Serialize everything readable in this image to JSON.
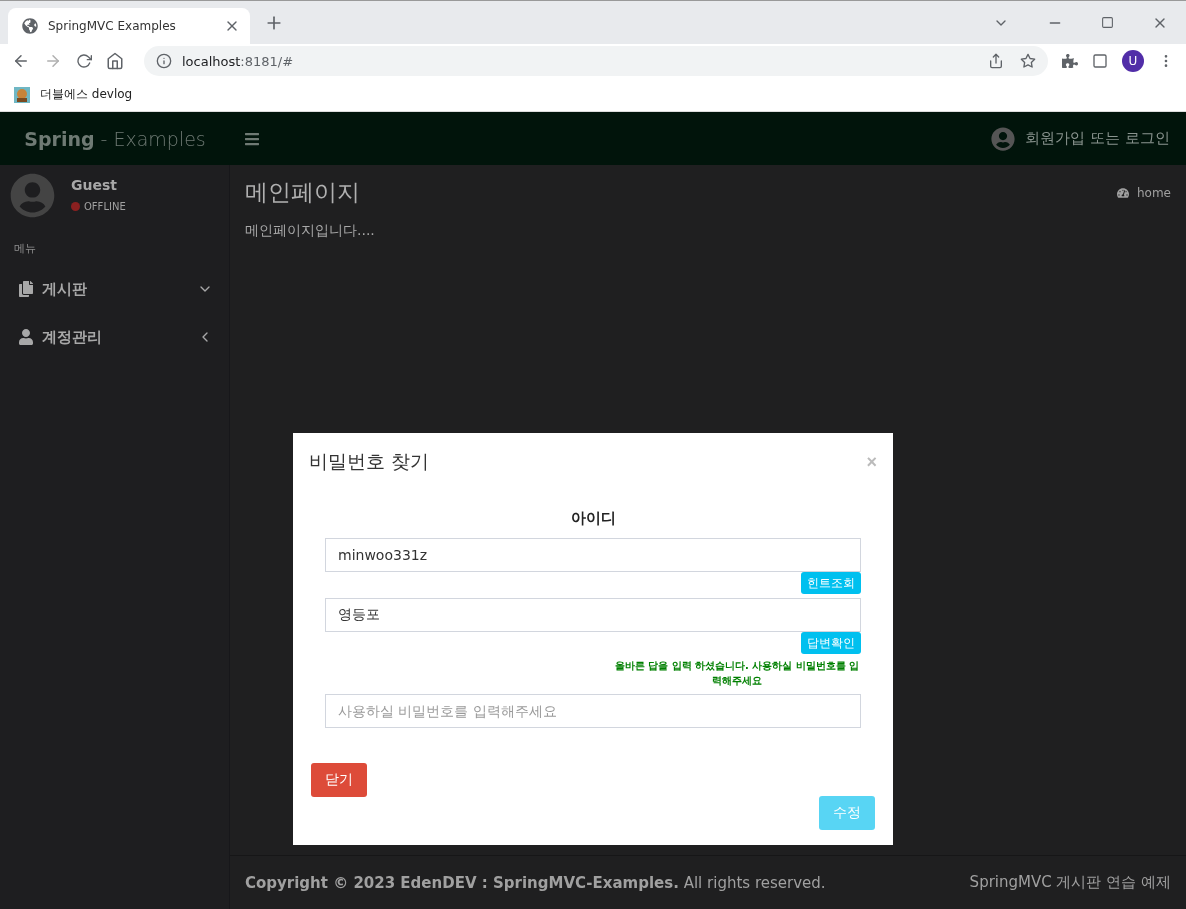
{
  "browser": {
    "tab_title": "SpringMVC Examples",
    "url_host": "localhost",
    "url_rest": ":8181/#",
    "bookmarks": [
      "더블에스 devlog"
    ],
    "profile_initial": "U"
  },
  "header": {
    "brand_bold": "Spring",
    "brand_rest": "- Examples",
    "account_link": "회원가입 또는 로그인"
  },
  "sidebar": {
    "user_name": "Guest",
    "status": "OFFLINE",
    "menu_header": "메뉴",
    "items": [
      {
        "label": "게시판",
        "kind": "files",
        "expanded": true
      },
      {
        "label": "계정관리",
        "kind": "user",
        "expanded": false
      }
    ]
  },
  "content": {
    "title": "메인페이지",
    "breadcrumb": "home",
    "body": "메인페이지입니다...."
  },
  "footer": {
    "copyright": "**Copyright © 2023 EdenDEV : SpringMVC-Examples.** All rights reserved.",
    "right_text": "SpringMVC 게시판 연습 예제"
  },
  "modal": {
    "title": "비밀번호 찾기",
    "close": "×",
    "label": "아이디",
    "id_field": {
      "value": "minwoo331z"
    },
    "hint_button": "힌트조회",
    "answer_field": {
      "value": "영등포"
    },
    "check_button": "답변확인",
    "message": "올바른 답을 입력 하셨습니다. 사용하실 비밀번호를 입력해주세요",
    "password_field": {
      "placeholder": "사용하실 비밀번호를 입력해주세요"
    },
    "cancel_button": "닫기",
    "submit_button": {
      "label": "수정",
      "disabled": true
    }
  }
}
